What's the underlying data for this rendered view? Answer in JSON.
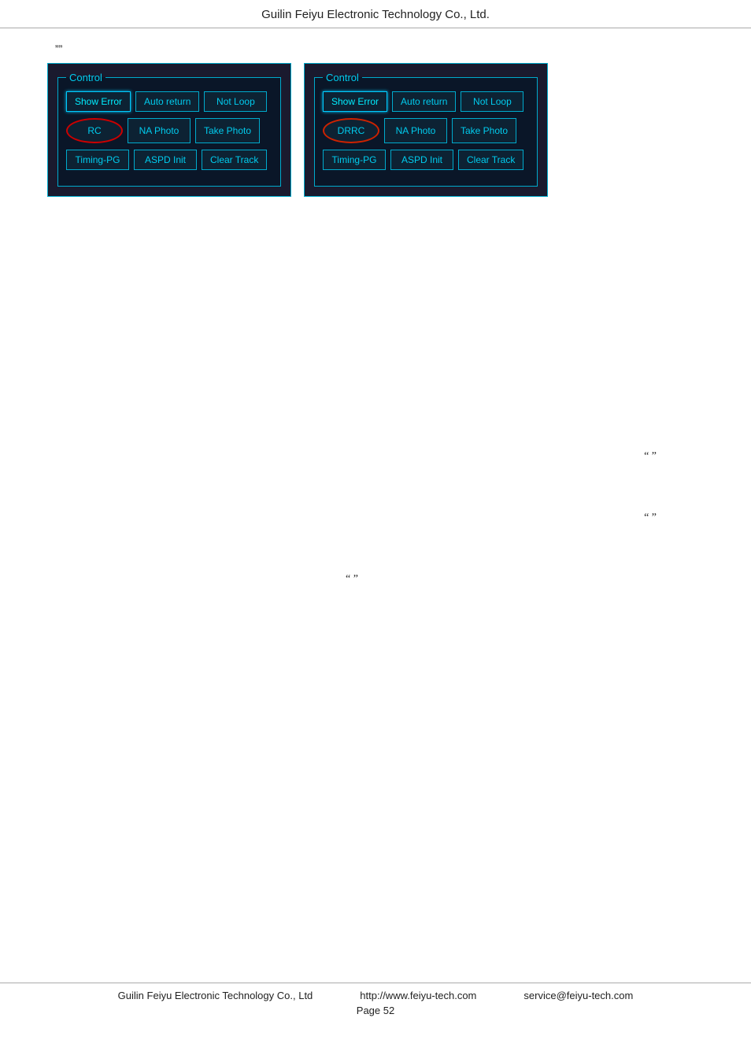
{
  "header": {
    "title": "Guilin Feiyu Electronic Technology Co., Ltd."
  },
  "footer": {
    "company": "Guilin Feiyu Electronic Technology Co., Ltd",
    "website": "http://www.feiyu-tech.com",
    "email": "service@feiyu-tech.com",
    "page_label": "Page 52"
  },
  "intro": {
    "quote": "””"
  },
  "panel_left": {
    "label": "Control",
    "row1": [
      {
        "id": "show-error-left",
        "text": "Show Error",
        "style": "active"
      },
      {
        "id": "auto-return-left",
        "text": "Auto return",
        "style": "normal"
      },
      {
        "id": "not-loop-left",
        "text": "Not Loop",
        "style": "normal"
      }
    ],
    "row2": [
      {
        "id": "rc-left",
        "text": "RC",
        "style": "rc"
      },
      {
        "id": "na-photo-left",
        "text": "NA Photo",
        "style": "normal"
      },
      {
        "id": "take-photo-left",
        "text": "Take Photo",
        "style": "normal"
      }
    ],
    "row3": [
      {
        "id": "timing-pg-left",
        "text": "Timing-PG",
        "style": "normal"
      },
      {
        "id": "aspd-init-left",
        "text": "ASPD Init",
        "style": "normal"
      },
      {
        "id": "clear-track-left",
        "text": "Clear Track",
        "style": "normal"
      }
    ]
  },
  "panel_right": {
    "label": "Control",
    "row1": [
      {
        "id": "show-error-right",
        "text": "Show Error",
        "style": "active"
      },
      {
        "id": "auto-return-right",
        "text": "Auto return",
        "style": "normal"
      },
      {
        "id": "not-loop-right",
        "text": "Not Loop",
        "style": "normal"
      }
    ],
    "row2": [
      {
        "id": "drrc-right",
        "text": "DRRC",
        "style": "drrc"
      },
      {
        "id": "na-photo-right",
        "text": "NA Photo",
        "style": "normal"
      },
      {
        "id": "take-photo-right",
        "text": "Take Photo",
        "style": "normal"
      }
    ],
    "row3": [
      {
        "id": "timing-pg-right",
        "text": "Timing-PG",
        "style": "normal"
      },
      {
        "id": "aspd-init-right",
        "text": "ASPD Init",
        "style": "normal"
      },
      {
        "id": "clear-track-right",
        "text": "Clear Track",
        "style": "normal"
      }
    ]
  },
  "body_texts": [
    {
      "id": "text1",
      "content": "",
      "right_quote": "“   ”"
    },
    {
      "id": "text2",
      "content": "",
      "right_quote": "“   ”"
    },
    {
      "id": "text3",
      "content": "",
      "center_quote": "“   ”"
    }
  ]
}
